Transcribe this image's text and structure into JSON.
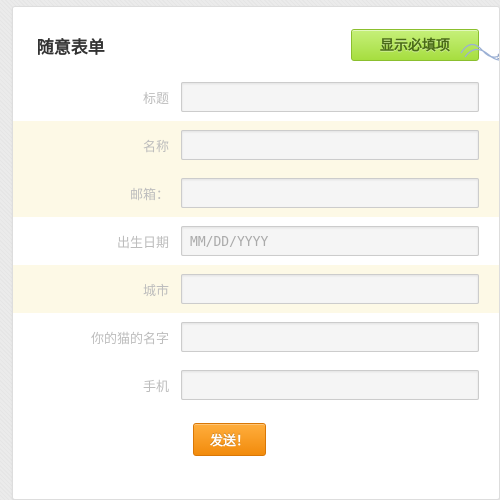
{
  "header": {
    "title": "随意表单",
    "show_required_btn": "显示必填项"
  },
  "fields": {
    "title": {
      "label": "标题",
      "value": "",
      "required": false
    },
    "name": {
      "label": "名称",
      "value": "",
      "required": true
    },
    "email": {
      "label": "邮箱：",
      "value": "",
      "required": true
    },
    "birthdate": {
      "label": "出生日期",
      "value": "",
      "placeholder": "MM/DD/YYYY",
      "required": false
    },
    "city": {
      "label": "城市",
      "value": "",
      "required": true
    },
    "catname": {
      "label": "你的猫的名字",
      "value": "",
      "required": false
    },
    "phone": {
      "label": "手机",
      "value": "",
      "required": false
    }
  },
  "submit_label": "发送！"
}
